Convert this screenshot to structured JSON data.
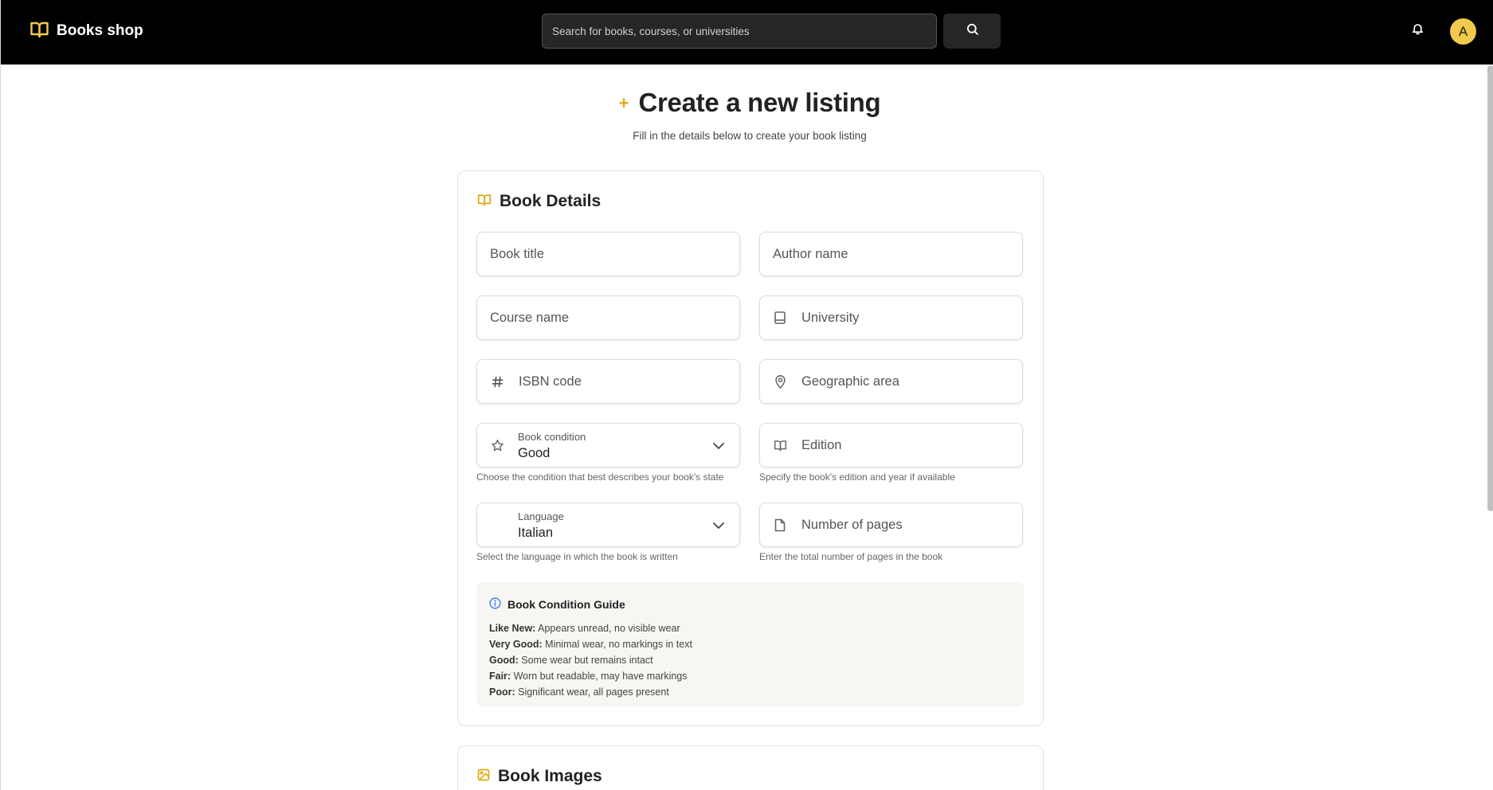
{
  "app": {
    "brand": "Books shop",
    "avatar_initial": "A"
  },
  "search": {
    "placeholder": "Search for books, courses, or universities"
  },
  "page": {
    "title": "Create a new listing",
    "subtitle": "Fill in the details below to create your book listing"
  },
  "book_details": {
    "section_title": "Book Details",
    "fields": {
      "book_title": {
        "placeholder": "Book title"
      },
      "author_name": {
        "placeholder": "Author name"
      },
      "course_name": {
        "placeholder": "Course name"
      },
      "university": {
        "placeholder": "University"
      },
      "isbn": {
        "placeholder": "ISBN code"
      },
      "geographic_area": {
        "placeholder": "Geographic area"
      },
      "book_condition": {
        "label": "Book condition",
        "value": "Good",
        "hint": "Choose the condition that best describes your book's state"
      },
      "edition": {
        "placeholder": "Edition",
        "hint": "Specify the book's edition and year if available"
      },
      "language": {
        "label": "Language",
        "value": "Italian",
        "hint": "Select the language in which the book is written"
      },
      "pages": {
        "placeholder": "Number of pages",
        "hint": "Enter the total number of pages in the book"
      }
    },
    "guide": {
      "title": "Book Condition Guide",
      "items": [
        {
          "term": "Like New:",
          "desc": " Appears unread, no visible wear"
        },
        {
          "term": "Very Good:",
          "desc": " Minimal wear, no markings in text"
        },
        {
          "term": "Good:",
          "desc": " Some wear but remains intact"
        },
        {
          "term": "Fair:",
          "desc": " Worn but readable, may have markings"
        },
        {
          "term": "Poor:",
          "desc": " Significant wear, all pages present"
        }
      ]
    }
  },
  "book_images": {
    "section_title": "Book Images"
  },
  "colors": {
    "accent": "#e3a812",
    "avatar": "#f2c94c",
    "topbar": "#000000",
    "info": "#3b82f6"
  }
}
